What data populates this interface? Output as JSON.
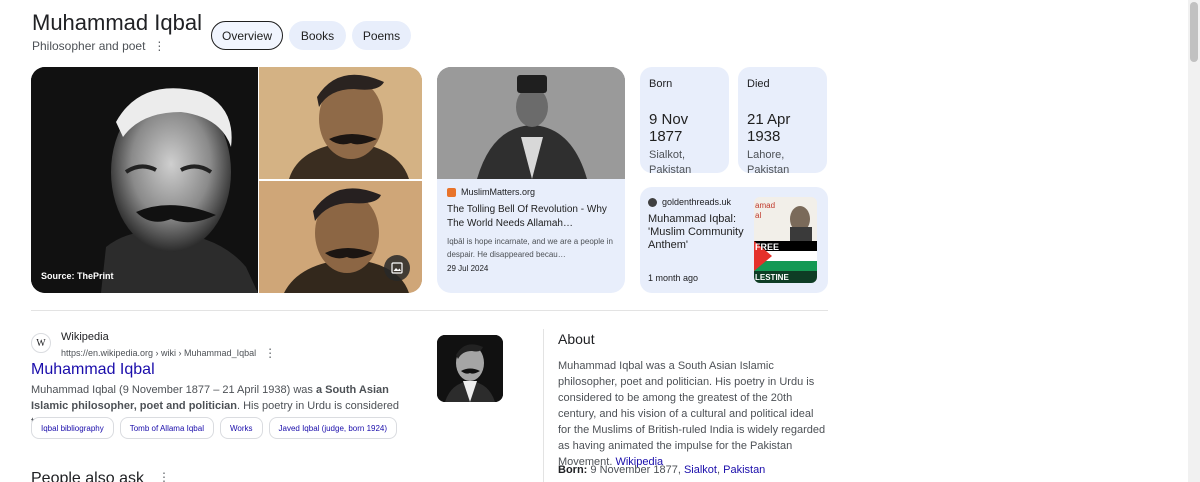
{
  "header": {
    "title": "Muhammad Iqbal",
    "subtitle": "Philosopher and poet"
  },
  "tabs": [
    {
      "label": "Overview"
    },
    {
      "label": "Books"
    },
    {
      "label": "Poems"
    }
  ],
  "photos": {
    "source_label": "Source: ThePrint"
  },
  "news": {
    "source": "MuslimMatters.org",
    "title": "The Tolling Bell Of Revolution - Why The World Needs Allamah…",
    "snippet": "Iqbāl is hope incarnate, and we are a people in despair. He disappeared becau…",
    "date": "29 Jul 2024"
  },
  "facts": {
    "born": {
      "label": "Born",
      "value": "9 Nov 1877",
      "place": "Sialkot, Pakistan"
    },
    "died": {
      "label": "Died",
      "value": "21 Apr 1938",
      "place": "Lahore, Pakistan"
    }
  },
  "goldenthreads": {
    "source": "goldenthreads.uk",
    "title": "Muhammad Iqbal: 'Muslim Community Anthem'",
    "time": "1 month ago",
    "thumb_text_top": "amad\nal",
    "thumb_text_banner": "FREE\nLESTINE"
  },
  "wikipedia": {
    "favicon": "W",
    "name": "Wikipedia",
    "url": "https://en.wikipedia.org › wiki › Muhammad_Iqbal",
    "title": "Muhammad Iqbal",
    "snippet_pre": "Muhammad Iqbal (9 November 1877 – 21 April 1938) was ",
    "snippet_bold": "a South Asian Islamic philosopher, poet and politician",
    "snippet_post": ". His poetry in Urdu is considered to be among ...",
    "chips": [
      "Iqbal bibliography",
      "Tomb of Allama Iqbal",
      "Works",
      "Javed Iqbal (judge, born 1924)"
    ]
  },
  "people_also_ask": "People also ask",
  "about": {
    "heading": "About",
    "text": "Muhammad Iqbal was a South Asian Islamic philosopher, poet and politician. His poetry in Urdu is considered to be among the greatest of the 20th century, and his vision of a cultural and political ideal for the Muslims of British-ruled India is widely regarded as having animated the impulse for the Pakistan Movement.",
    "link": "Wikipedia",
    "born_label": "Born:",
    "born_value": "9 November 1877,",
    "born_city": "Sialkot",
    "born_sep": ",",
    "born_country": "Pakistan"
  },
  "icons": {
    "more": "more-vert-icon",
    "image": "image-icon"
  }
}
